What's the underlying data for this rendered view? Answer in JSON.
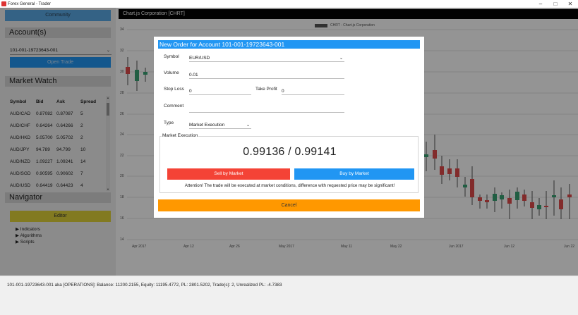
{
  "window": {
    "title": "Forex General - Trader",
    "minimize": "–",
    "maximize": "□",
    "close": "✕"
  },
  "sidebar": {
    "community_label": "Community",
    "accounts_header": "Account(s)",
    "account_selected": "101-001-19723643-001",
    "open_trade_label": "Open Trade",
    "market_watch_header": "Market Watch",
    "columns": [
      "Symbol",
      "Bid",
      "Ask",
      "Spread"
    ],
    "rows": [
      [
        "AUD/CAD",
        "0.87082",
        "0.87087",
        "5"
      ],
      [
        "AUD/CHF",
        "0.64264",
        "0.64266",
        "2"
      ],
      [
        "AUD/HKD",
        "5.05700",
        "5.05702",
        "2"
      ],
      [
        "AUD/JPY",
        "94.789",
        "94.799",
        "10"
      ],
      [
        "AUD/NZD",
        "1.09227",
        "1.09241",
        "14"
      ],
      [
        "AUD/SGD",
        "0.90595",
        "0.90602",
        "7"
      ],
      [
        "AUD/USD",
        "0.64419",
        "0.64423",
        "4"
      ]
    ],
    "navigator_header": "Navigator",
    "editor_label": "Editor",
    "tree": [
      "▶  Indicators",
      "▶  Algorithms",
      "▶  Scripts"
    ]
  },
  "chart": {
    "header": "Chart.js Corporation [CHRT]",
    "legend": "CHRT - Chart.js Corporation",
    "yticks": [
      "34",
      "32",
      "30",
      "28",
      "26",
      "24",
      "22",
      "20",
      "18",
      "16",
      "14"
    ],
    "xticks": [
      "Apr 2017",
      "Apr 12",
      "Apr 26",
      "May 2017",
      "May 11",
      "May 22",
      "Jun 2017",
      "Jun 12",
      "Jun 22"
    ],
    "up_color": "#3aa374",
    "down_color": "#e14b4b"
  },
  "modal": {
    "title": "New Order for Account 101-001-19723643-001",
    "symbol_label": "Symbol",
    "symbol_value": "EUR/USD",
    "volume_label": "Volume",
    "volume_value": "0.01",
    "stop_loss_label": "Stop Loss",
    "stop_loss_value": "0",
    "take_profit_label": "Take Profit",
    "take_profit_value": "0",
    "comment_label": "Comment",
    "comment_value": "",
    "type_label": "Type",
    "type_value": "Market Execution",
    "section_legend": "Market Execution",
    "price": "0.99136 / 0.99141",
    "sell_label": "Sell by Market",
    "buy_label": "Buy by Market",
    "attention": "Attention! The trade will be executed at market conditions, difference with requested price may be significant!",
    "cancel_label": "Cancel"
  },
  "status": {
    "text": "101-001-19723643-001 aka [OPERATIONS]: Balance: 11200.2155, Equity: 11195.4772, PL: 2801.5202, Trade(s): 2, Unrealized PL: -4.7383"
  }
}
